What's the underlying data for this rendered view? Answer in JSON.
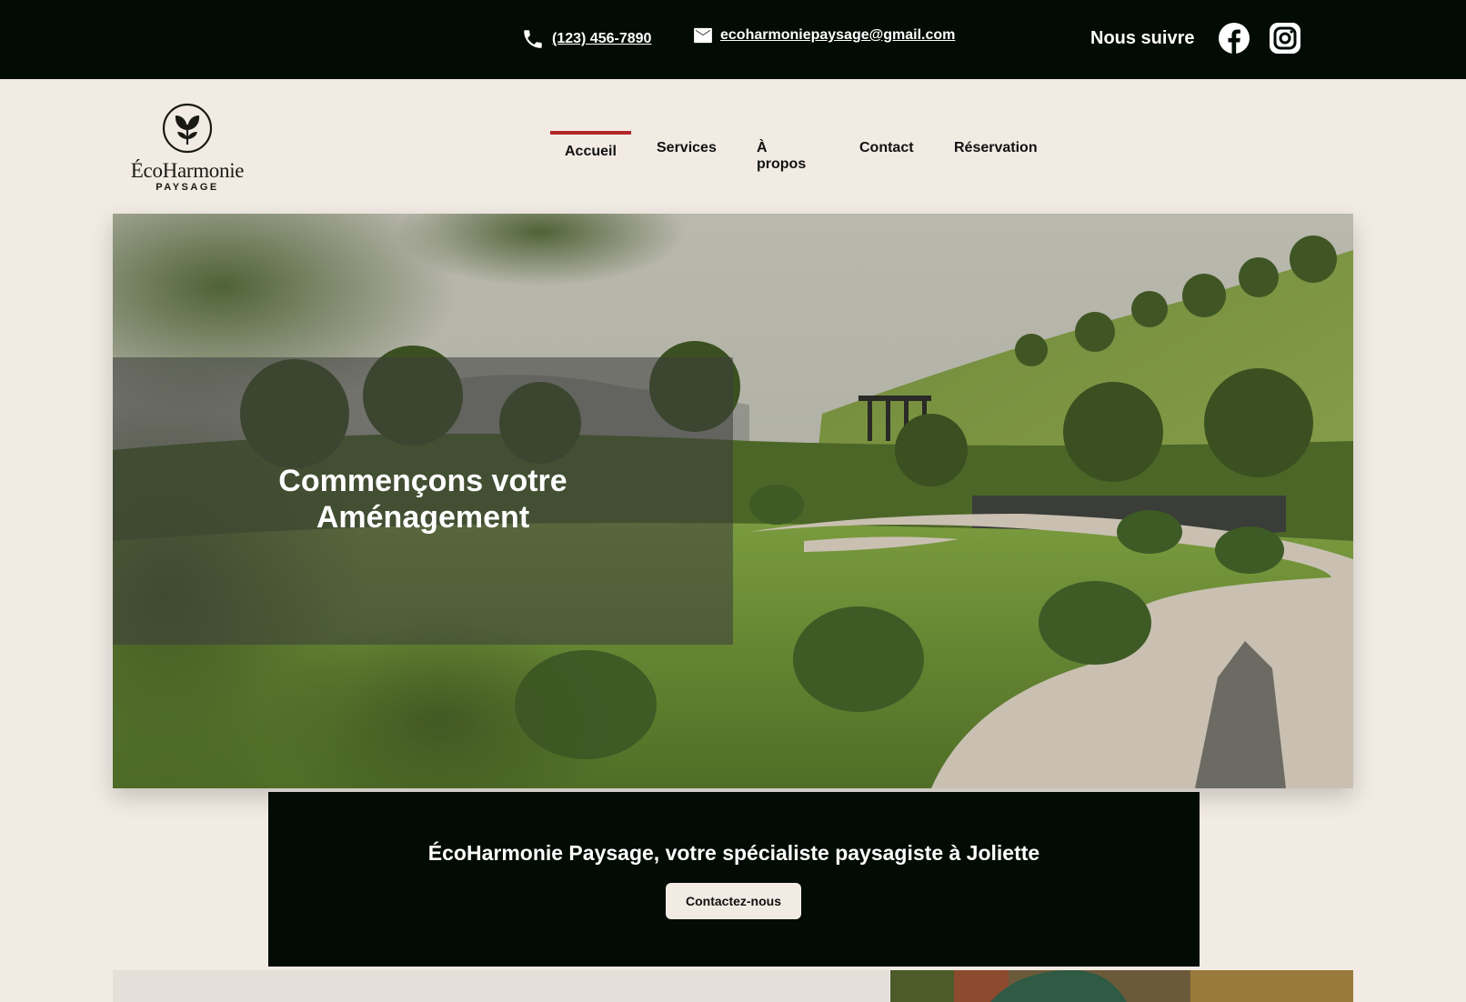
{
  "topbar": {
    "phone": "(123) 456-7890",
    "email": "ecoharmoniepaysage@gmail.com",
    "follow_label": "Nous suivre",
    "phone_icon": "phone-icon",
    "email_icon": "mail-icon",
    "social_icons": [
      "facebook-icon",
      "instagram-icon"
    ]
  },
  "logo": {
    "name": "ÉcoHarmonie",
    "subtitle": "PAYSAGE"
  },
  "nav": {
    "items": [
      {
        "label": "Accueil",
        "active": true
      },
      {
        "label": "Services",
        "active": false
      },
      {
        "label": "À propos",
        "active": false
      },
      {
        "label": "Contact",
        "active": false
      },
      {
        "label": "Réservation",
        "active": false
      }
    ]
  },
  "hero": {
    "title_line1": "Commençons votre",
    "title_line2": "Aménagement"
  },
  "banner": {
    "text": "ÉcoHarmonie Paysage, votre spécialiste paysagiste à Joliette",
    "button_label": "Contactez-nous"
  },
  "colors": {
    "dark": "#020b04",
    "background": "#f2ebe4",
    "accent": "#b1262a"
  }
}
